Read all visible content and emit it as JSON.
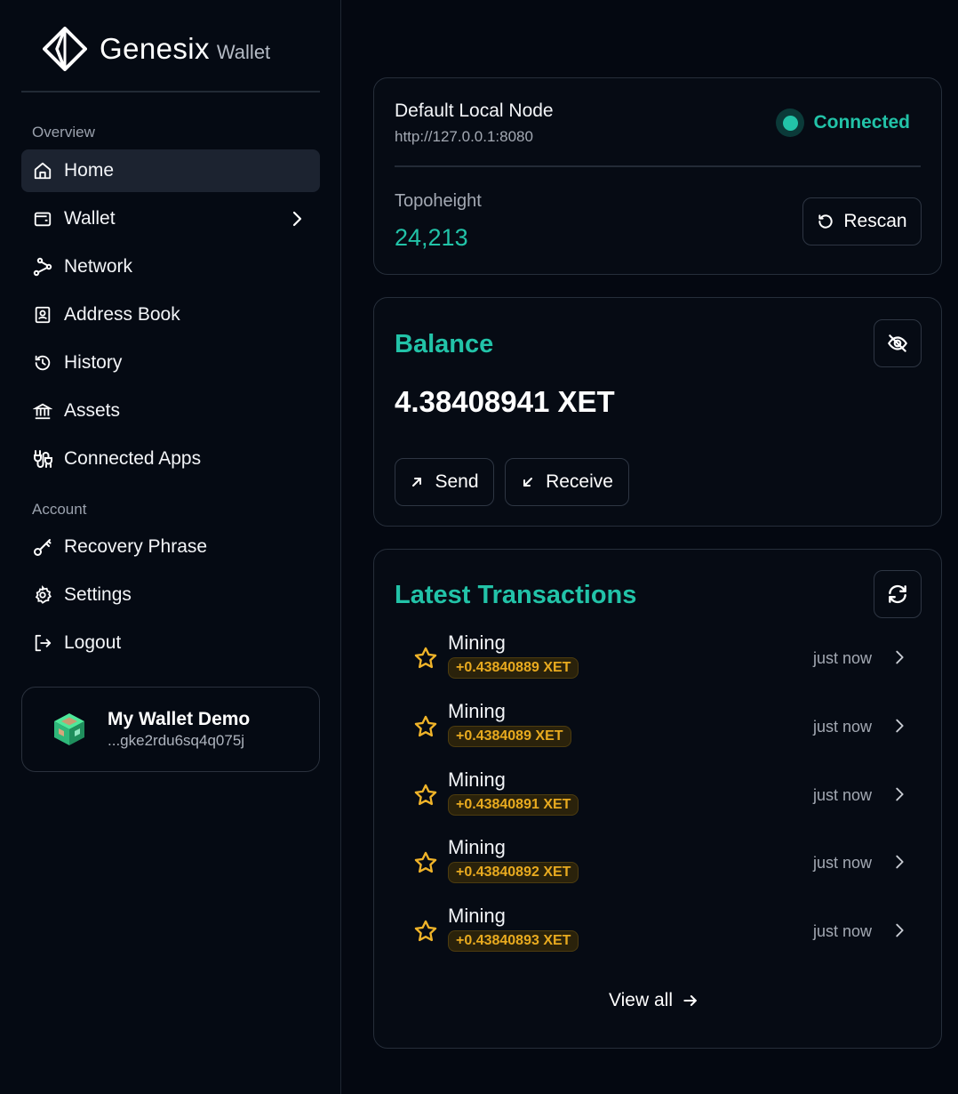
{
  "app": {
    "brand": "Genesix",
    "brand_sub": "Wallet"
  },
  "sidebar": {
    "sections": {
      "overview": "Overview",
      "account": "Account"
    },
    "items": [
      {
        "label": "Home",
        "icon": "home-icon",
        "active": true
      },
      {
        "label": "Wallet",
        "icon": "wallet-icon"
      },
      {
        "label": "Network",
        "icon": "network-icon"
      },
      {
        "label": "Address Book",
        "icon": "contact-book-icon"
      },
      {
        "label": "History",
        "icon": "history-icon"
      },
      {
        "label": "Assets",
        "icon": "bank-icon"
      },
      {
        "label": "Connected Apps",
        "icon": "plug-icon"
      },
      {
        "label": "Recovery Phrase",
        "icon": "key-icon"
      },
      {
        "label": "Settings",
        "icon": "gear-icon"
      },
      {
        "label": "Logout",
        "icon": "logout-icon"
      }
    ],
    "wallet_card": {
      "name": "My Wallet Demo",
      "address": "...gke2rdu6sq4q075j"
    }
  },
  "node": {
    "name": "Default Local Node",
    "url": "http://127.0.0.1:8080",
    "status": "Connected",
    "status_color": "#22c3a8",
    "topoheight_label": "Topoheight",
    "topoheight_value": "24,213",
    "rescan_label": "Rescan"
  },
  "balance": {
    "title": "Balance",
    "value": "4.38408941 XET",
    "send_label": "Send",
    "receive_label": "Receive"
  },
  "transactions": {
    "title": "Latest Transactions",
    "items": [
      {
        "type": "Mining",
        "amount": "+0.43840889 XET",
        "time": "just now"
      },
      {
        "type": "Mining",
        "amount": "+0.4384089 XET",
        "time": "just now"
      },
      {
        "type": "Mining",
        "amount": "+0.43840891 XET",
        "time": "just now"
      },
      {
        "type": "Mining",
        "amount": "+0.43840892 XET",
        "time": "just now"
      },
      {
        "type": "Mining",
        "amount": "+0.43840893 XET",
        "time": "just now"
      }
    ],
    "view_all_label": "View all"
  },
  "colors": {
    "accent": "#22c3a8",
    "reward": "#e8aa1f",
    "background": "#040811"
  }
}
